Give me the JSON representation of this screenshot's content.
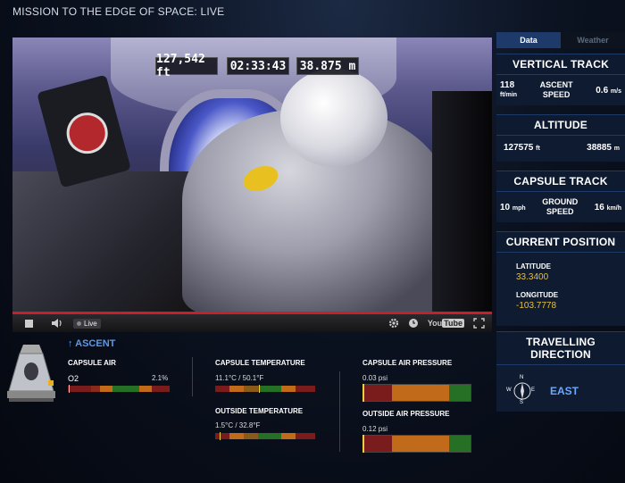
{
  "header": {
    "title": "MISSION TO THE EDGE OF SPACE: LIVE"
  },
  "video": {
    "hud_altitude_ft": "127,542 ft",
    "hud_time": "02:33:43",
    "hud_altitude_m": "38.875 m"
  },
  "player": {
    "live_label": "Live",
    "youtube_label": "You",
    "youtube_tube": "Tube"
  },
  "tabs": {
    "data": "Data",
    "weather": "Weather",
    "active": "Data"
  },
  "vertical_track": {
    "title": "VERTICAL TRACK",
    "rate_value": "118",
    "rate_unit": "ft/min",
    "mid_label_1": "ASCENT",
    "mid_label_2": "SPEED",
    "speed_value": "0.6",
    "speed_unit": "m/s"
  },
  "altitude": {
    "title": "ALTITUDE",
    "ft_value": "127575",
    "ft_unit": "ft",
    "m_value": "38885",
    "m_unit": "m"
  },
  "capsule_track": {
    "title": "CAPSULE TRACK",
    "mph_value": "10",
    "mph_unit": "mph",
    "mid_label_1": "GROUND",
    "mid_label_2": "SPEED",
    "kmh_value": "16",
    "kmh_unit": "km/h"
  },
  "position": {
    "title": "CURRENT POSITION",
    "lat_label": "LATITUDE",
    "lat_value": "33.3400",
    "lon_label": "LONGITUDE",
    "lon_value": "-103.7778"
  },
  "direction": {
    "title": "TRAVELLING DIRECTION",
    "value": "EAST",
    "compass_n": "N",
    "compass_s": "S",
    "compass_e": "E",
    "compass_w": "W"
  },
  "status": {
    "phase": "ASCENT",
    "capsule_air_label": "CAPSULE AIR",
    "o2_label": "O2",
    "o2_value": "2.1%",
    "capsule_temp_label": "CAPSULE TEMPERATURE",
    "capsule_temp_value": "11.1°C / 50.1°F",
    "outside_temp_label": "OUTSIDE TEMPERATURE",
    "outside_temp_value": "1.5°C / 32.8°F",
    "capsule_pressure_label": "CAPSULE AIR PRESSURE",
    "capsule_pressure_value": "0.03 psi",
    "outside_pressure_label": "OUTSIDE AIR PRESSURE",
    "outside_pressure_value": "0.12 psi"
  },
  "colors": {
    "accent_blue": "#5a9ae8",
    "live_red": "#c8202a",
    "coord_yellow": "#e8c040",
    "bar_red": "#8a1e1e",
    "bar_orange": "#c86a1a",
    "bar_green": "#2a7a2a"
  }
}
